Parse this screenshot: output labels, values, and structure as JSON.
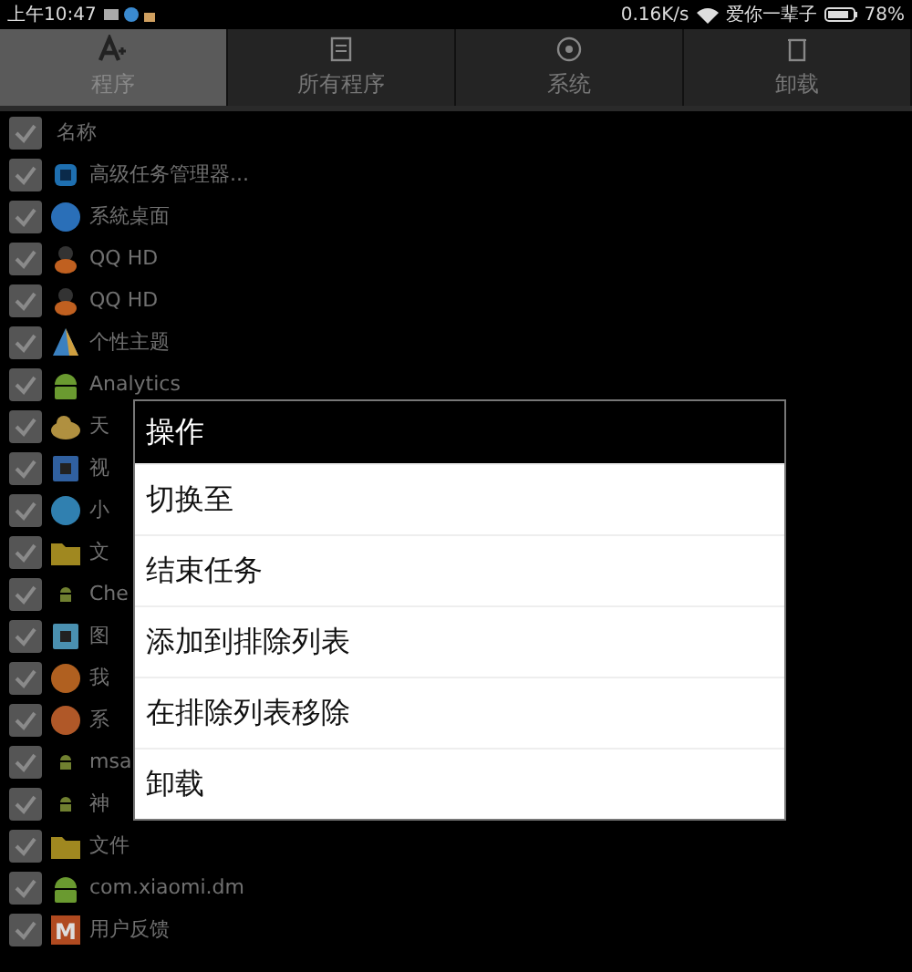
{
  "status_bar": {
    "time": "上午10:47",
    "speed": "0.16K/s",
    "network_name": "爱你一辈子",
    "battery": "78%"
  },
  "tabs": [
    {
      "label": "程序",
      "selected": true
    },
    {
      "label": "所有程序",
      "selected": false
    },
    {
      "label": "系统",
      "selected": false
    },
    {
      "label": "卸载",
      "selected": false
    }
  ],
  "list_header": {
    "label": "名称",
    "checked": true
  },
  "items": [
    {
      "name": "高级任务管理器...",
      "checked": true,
      "kind": "chip",
      "color": "#1e6fb0"
    },
    {
      "name": "系統桌面",
      "checked": true,
      "kind": "circle",
      "color": "#2a6fb8"
    },
    {
      "name": "QQ HD",
      "checked": true,
      "kind": "figure",
      "color": "#c06020"
    },
    {
      "name": "QQ HD",
      "checked": true,
      "kind": "figure",
      "color": "#c06020"
    },
    {
      "name": "个性主题",
      "checked": true,
      "kind": "fan",
      "color": "#3a80c0"
    },
    {
      "name": "Analytics",
      "checked": true,
      "kind": "android",
      "color": "#6a9a30"
    },
    {
      "name": "天",
      "checked": true,
      "kind": "cloud",
      "color": "#b09040"
    },
    {
      "name": "视",
      "checked": true,
      "kind": "square",
      "color": "#3060a0"
    },
    {
      "name": "小",
      "checked": true,
      "kind": "circle",
      "color": "#3080b0"
    },
    {
      "name": "文",
      "checked": true,
      "kind": "folder",
      "color": "#a08820"
    },
    {
      "name": "Che",
      "checked": true,
      "kind": "android-small",
      "color": "#708030"
    },
    {
      "name": "图",
      "checked": true,
      "kind": "square",
      "color": "#4a90b0"
    },
    {
      "name": "我",
      "checked": true,
      "kind": "circle",
      "color": "#b06020"
    },
    {
      "name": "系",
      "checked": true,
      "kind": "circle",
      "color": "#b05828"
    },
    {
      "name": "msa",
      "checked": true,
      "kind": "android-small",
      "color": "#708030"
    },
    {
      "name": "神",
      "checked": true,
      "kind": "android-small",
      "color": "#708030"
    },
    {
      "name": "文件",
      "checked": true,
      "kind": "folder",
      "color": "#a08820"
    },
    {
      "name": "com.xiaomi.dm",
      "checked": true,
      "kind": "android",
      "color": "#6a9a30"
    },
    {
      "name": "用户反馈",
      "checked": true,
      "kind": "letter",
      "color": "#b04a20",
      "letter": "M"
    }
  ],
  "dialog": {
    "title": "操作",
    "actions": [
      "切换至",
      "结束任务",
      "添加到排除列表",
      "在排除列表移除",
      "卸载"
    ]
  }
}
